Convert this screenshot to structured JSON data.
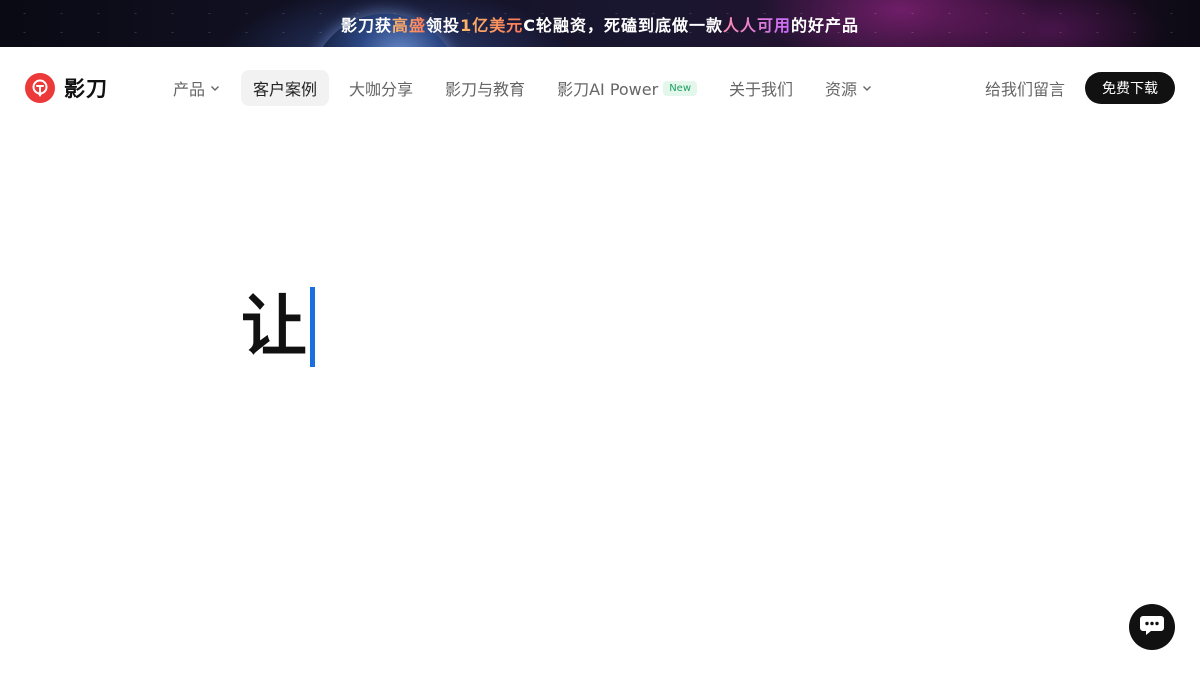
{
  "banner": {
    "segments": [
      {
        "text": "影刀获",
        "style": "plain"
      },
      {
        "text": "高盛",
        "style": "orange"
      },
      {
        "text": "领投",
        "style": "plain"
      },
      {
        "text": "1亿美元",
        "style": "orange"
      },
      {
        "text": "C轮融资，死磕到底做一款",
        "style": "plain"
      },
      {
        "text": "人人可用",
        "style": "pink"
      },
      {
        "text": "的好产品",
        "style": "plain"
      }
    ]
  },
  "logo": {
    "text": "影刀",
    "icon": "yingdao-logo-icon",
    "color": "#ec3a3a"
  },
  "nav": {
    "items": [
      {
        "label": "产品",
        "dropdown": true,
        "active": false
      },
      {
        "label": "客户案例",
        "dropdown": false,
        "active": true
      },
      {
        "label": "大咖分享",
        "dropdown": false,
        "active": false
      },
      {
        "label": "影刀与教育",
        "dropdown": false,
        "active": false
      },
      {
        "label": "影刀AI Power",
        "dropdown": false,
        "active": false,
        "badge": "New"
      },
      {
        "label": "关于我们",
        "dropdown": false,
        "active": false
      },
      {
        "label": "资源",
        "dropdown": true,
        "active": false
      }
    ],
    "leave_message": "给我们留言",
    "download": "免费下载"
  },
  "hero": {
    "typed_text": "让",
    "caret_color": "#1a6fe0"
  },
  "chat": {
    "icon": "chat-bubble-icon"
  }
}
